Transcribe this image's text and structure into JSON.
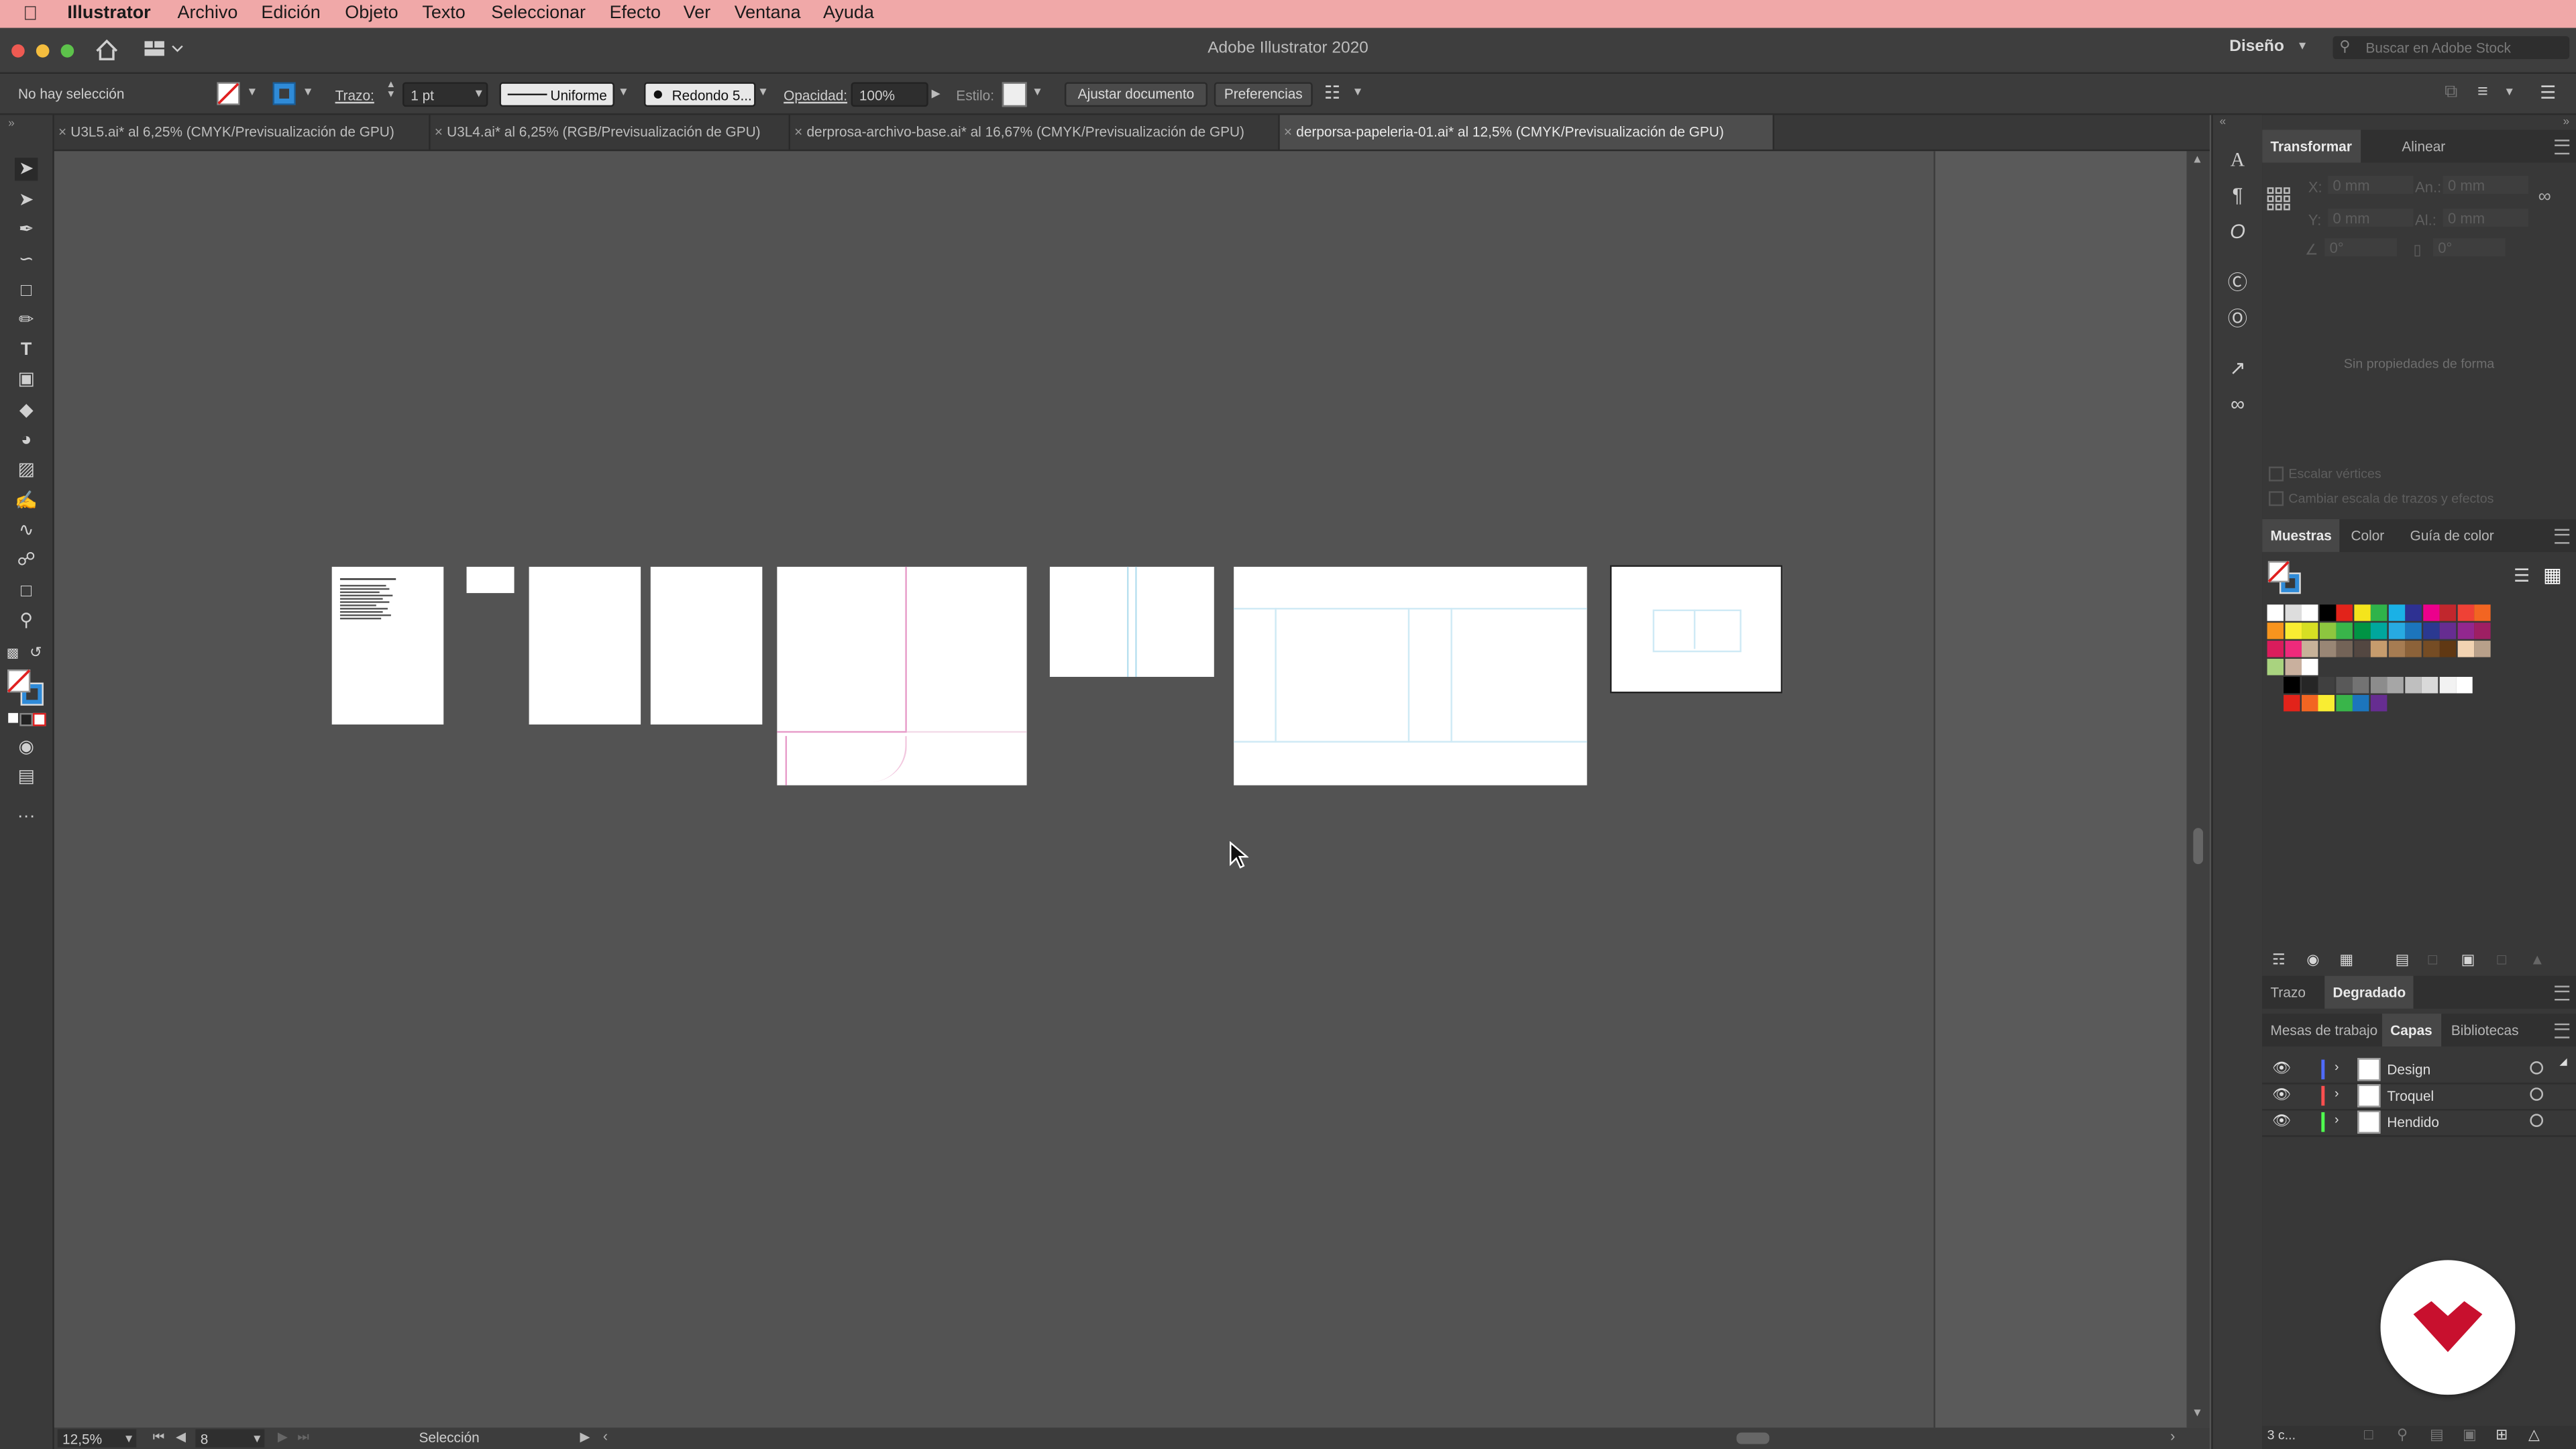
{
  "menubar": {
    "app": "Illustrator",
    "items": [
      "Archivo",
      "Edición",
      "Objeto",
      "Texto",
      "Seleccionar",
      "Efecto",
      "Ver",
      "Ventana",
      "Ayuda"
    ]
  },
  "window": {
    "title": "Adobe Illustrator 2020",
    "workspace": "Diseño",
    "search_placeholder": "Buscar en Adobe Stock"
  },
  "control": {
    "selection": "No hay selección",
    "stroke_label": "Trazo:",
    "stroke_value": "1 pt",
    "profile": "Uniforme",
    "brush": "Redondo 5...",
    "opacity_label": "Opacidad:",
    "opacity_value": "100%",
    "style_label": "Estilo:",
    "fit_button": "Ajustar documento",
    "prefs_button": "Preferencias"
  },
  "tabs": [
    {
      "label": "U3L5.ai* al 6,25% (CMYK/Previsualización de GPU)",
      "active": false
    },
    {
      "label": "U3L4.ai* al 6,25% (RGB/Previsualización de GPU)",
      "active": false
    },
    {
      "label": "derprosa-archivo-base.ai* al 16,67% (CMYK/Previsualización de GPU)",
      "active": false
    },
    {
      "label": "derporsa-papeleria-01.ai* al 12,5% (CMYK/Previsualización de GPU)",
      "active": true
    }
  ],
  "status": {
    "zoom": "12,5%",
    "artboard": "8",
    "tool": "Selección"
  },
  "transform_panel": {
    "tabs": [
      "Transformar",
      "Alinear"
    ],
    "x_label": "X:",
    "y_label": "Y:",
    "w_label": "An.:",
    "h_label": "Al.:",
    "x_value": "0 mm",
    "y_value": "0 mm",
    "w_value": "0 mm",
    "h_value": "0 mm",
    "angle_value": "0°",
    "shear_value": "0°",
    "empty_message": "Sin propiedades de forma",
    "scale_corners": "Escalar vértices",
    "scale_strokes": "Cambiar escala de trazos y efectos"
  },
  "swatches_panel": {
    "tabs": [
      "Muestras",
      "Color",
      "Guía de color"
    ]
  },
  "stroke_panel": {
    "tabs": [
      "Trazo",
      "Degradado"
    ]
  },
  "layers_panel": {
    "tabs": [
      "Mesas de trabajo",
      "Capas",
      "Bibliotecas"
    ],
    "layers": [
      {
        "name": "Design",
        "color": "#4f6bff"
      },
      {
        "name": "Troquel",
        "color": "#ff4f4f"
      },
      {
        "name": "Hendido",
        "color": "#4fff4f"
      }
    ],
    "count": "3 c..."
  },
  "colors": {
    "menubar": "#f0a8a8",
    "ui_dark": "#383838",
    "canvas": "#535353",
    "brand_red": "#c8102e"
  }
}
